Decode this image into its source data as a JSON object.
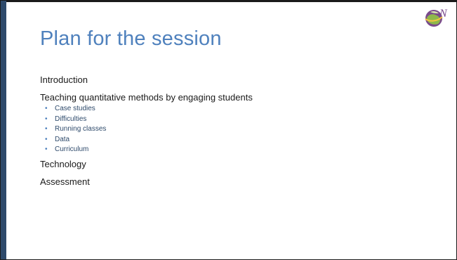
{
  "slide": {
    "title": "Plan for the session",
    "items": [
      {
        "label": "Introduction"
      },
      {
        "label": "Teaching quantitative methods by engaging students",
        "subitems": [
          "Case studies",
          "Difficulties",
          "Running classes",
          "Data",
          "Curriculum"
        ]
      },
      {
        "label": "Technology"
      },
      {
        "label": "Assessment"
      }
    ],
    "bullet_glyph": "•",
    "colors": {
      "title": "#4f81bd",
      "accent_bar": "#2e4a6b",
      "body_text": "#1a1a1a",
      "subitem_text": "#2e4a6b"
    }
  },
  "logo": {
    "icon": "globe-swoosh-logo-icon",
    "text": "N"
  }
}
